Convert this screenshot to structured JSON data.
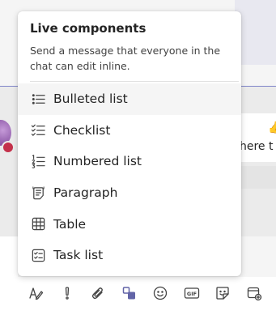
{
  "popup": {
    "title": "Live components",
    "description": "Send a message that everyone in the chat can edit inline.",
    "items": [
      {
        "label": "Bulleted list",
        "icon": "bulleted-list-icon"
      },
      {
        "label": "Checklist",
        "icon": "checklist-icon"
      },
      {
        "label": "Numbered list",
        "icon": "numbered-list-icon"
      },
      {
        "label": "Paragraph",
        "icon": "paragraph-icon"
      },
      {
        "label": "Table",
        "icon": "table-icon"
      },
      {
        "label": "Task list",
        "icon": "task-list-icon"
      }
    ],
    "highlighted_item": "Bulleted list"
  },
  "chat": {
    "message_fragment": "here t"
  },
  "toolbar": {
    "buttons": [
      {
        "icon": "format-icon"
      },
      {
        "icon": "important-icon"
      },
      {
        "icon": "attach-icon"
      },
      {
        "icon": "loop-components-icon"
      },
      {
        "icon": "emoji-icon"
      },
      {
        "icon": "gif-icon",
        "label": "GIF"
      },
      {
        "icon": "sticker-icon"
      },
      {
        "icon": "schedule-meeting-icon"
      }
    ]
  },
  "colors": {
    "accent": "#6264a7",
    "status_busy": "#c4314b"
  }
}
